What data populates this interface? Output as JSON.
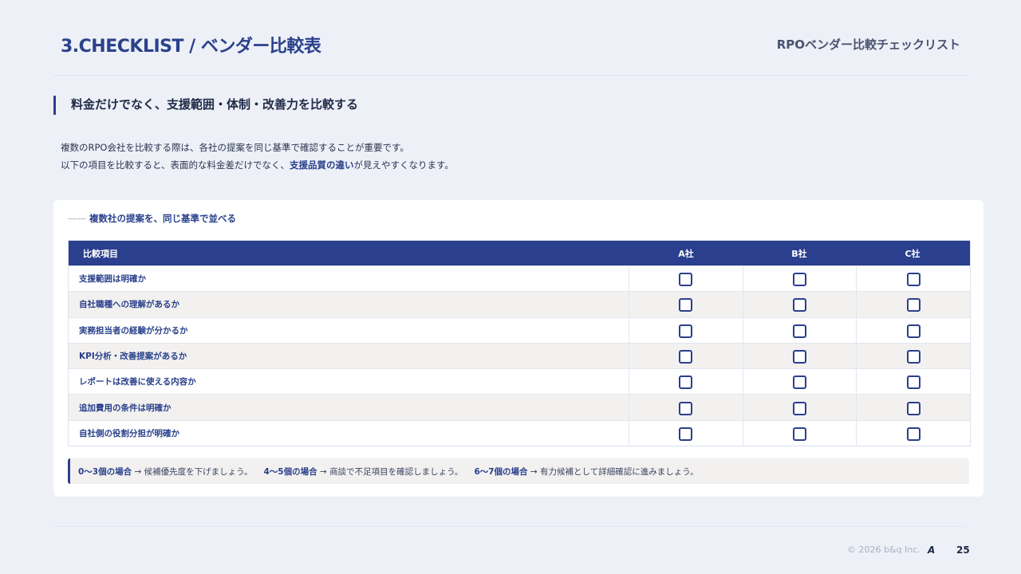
{
  "header": {
    "title": "3.CHECKLIST / ベンダー比較表",
    "subtitle": "RPOベンダー比較チェックリスト"
  },
  "section": {
    "heading": "料金だけでなく、支援範囲・体制・改善力を比較する",
    "intro_line1": "複数のRPO会社を比較する際は、各社の提案を同じ基準で確認することが重要です。",
    "intro_line2_pre": "以下の項目を比較すると、表面的な料金差だけでなく、",
    "intro_line2_em": "支援品質の違い",
    "intro_line2_post": "が見えやすくなります。"
  },
  "card": {
    "label_dash": "——",
    "label": "複数社の提案を、同じ基準で並べる"
  },
  "table": {
    "headers": [
      "比較項目",
      "A社",
      "B社",
      "C社"
    ],
    "rows": [
      "支援範囲は明確か",
      "自社職種への理解があるか",
      "実務担当者の経験が分かるか",
      "KPI分析・改善提案があるか",
      "レポートは改善に使える内容か",
      "追加費用の条件は明確か",
      "自社側の役割分担が明確か"
    ],
    "checkbox_icon": "checkbox-empty-icon"
  },
  "note": {
    "s1_key": "0〜3個の場合",
    "s1_text": " → 候補優先度を下げましょう。",
    "s2_key": "4〜5個の場合",
    "s2_text": " → 商談で不足項目を確認しましょう。",
    "s3_key": "6〜7個の場合",
    "s3_text": " → 有力候補として詳細確認に進みましょう。"
  },
  "footer": {
    "copyright": "© 2026 b&q Inc.",
    "logo": "A",
    "page_number": "25"
  },
  "colors": {
    "accent": "#2a418c",
    "table_header_bg": "#2a3f8d",
    "page_bg": "#edf0f7"
  }
}
